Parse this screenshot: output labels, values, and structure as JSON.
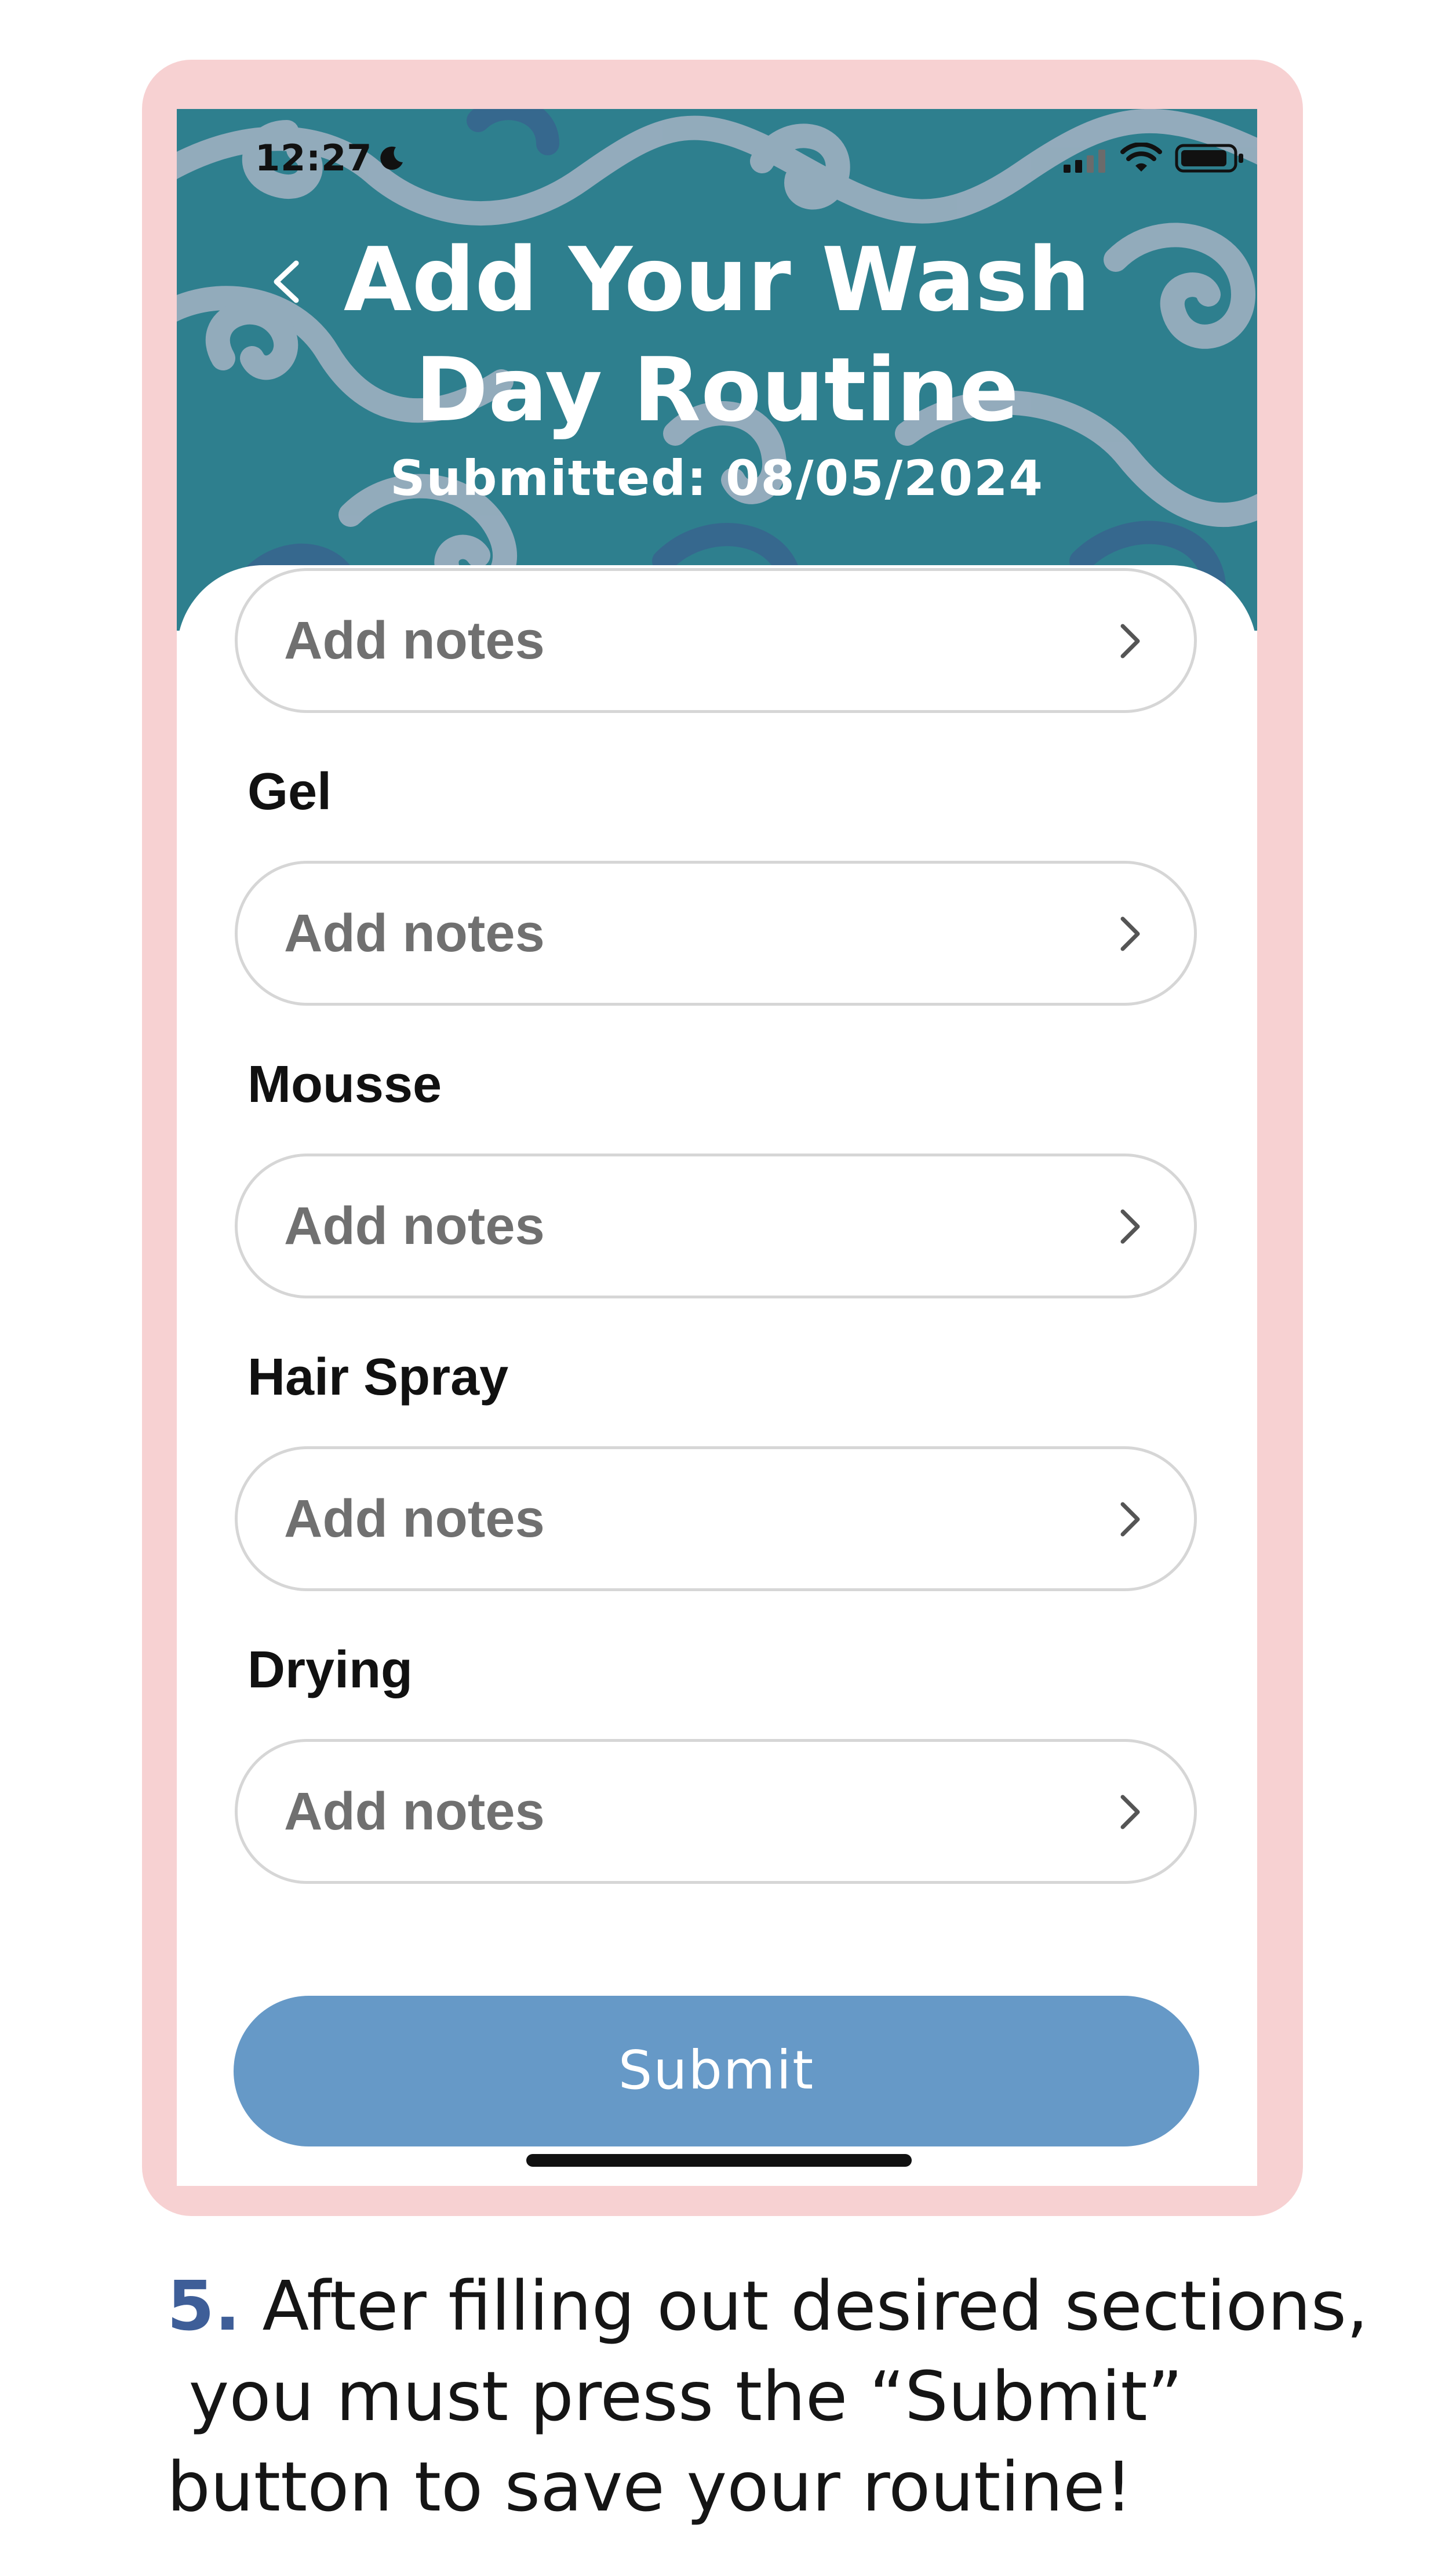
{
  "status_bar": {
    "time": "12:27",
    "moon_icon": "moon-icon",
    "signal_icon": "cellular-signal-icon",
    "wifi_icon": "wifi-icon",
    "battery_icon": "battery-icon"
  },
  "header": {
    "back_icon": "chevron-left-icon",
    "title": "Add Your Wash Day Routine",
    "submitted": "Submitted: 08/05/2024",
    "background_color": "#2e7f8e"
  },
  "form": {
    "fields": [
      {
        "label": "",
        "value": "Add notes"
      },
      {
        "label": "Gel",
        "value": "Add notes"
      },
      {
        "label": "Mousse",
        "value": "Add notes"
      },
      {
        "label": "Hair Spray",
        "value": "Add notes"
      },
      {
        "label": "Drying",
        "value": "Add notes"
      }
    ],
    "chevron_icon": "chevron-right-icon",
    "submit_label": "Submit",
    "submit_color": "#6699c7"
  },
  "frame_color": "#f7d1d2",
  "caption": {
    "step": "5.",
    "line1": " After filling out desired sections,",
    "line2": " you must press the “Submit”",
    "line3": "button to save your routine!",
    "step_color": "#3e5e98"
  }
}
